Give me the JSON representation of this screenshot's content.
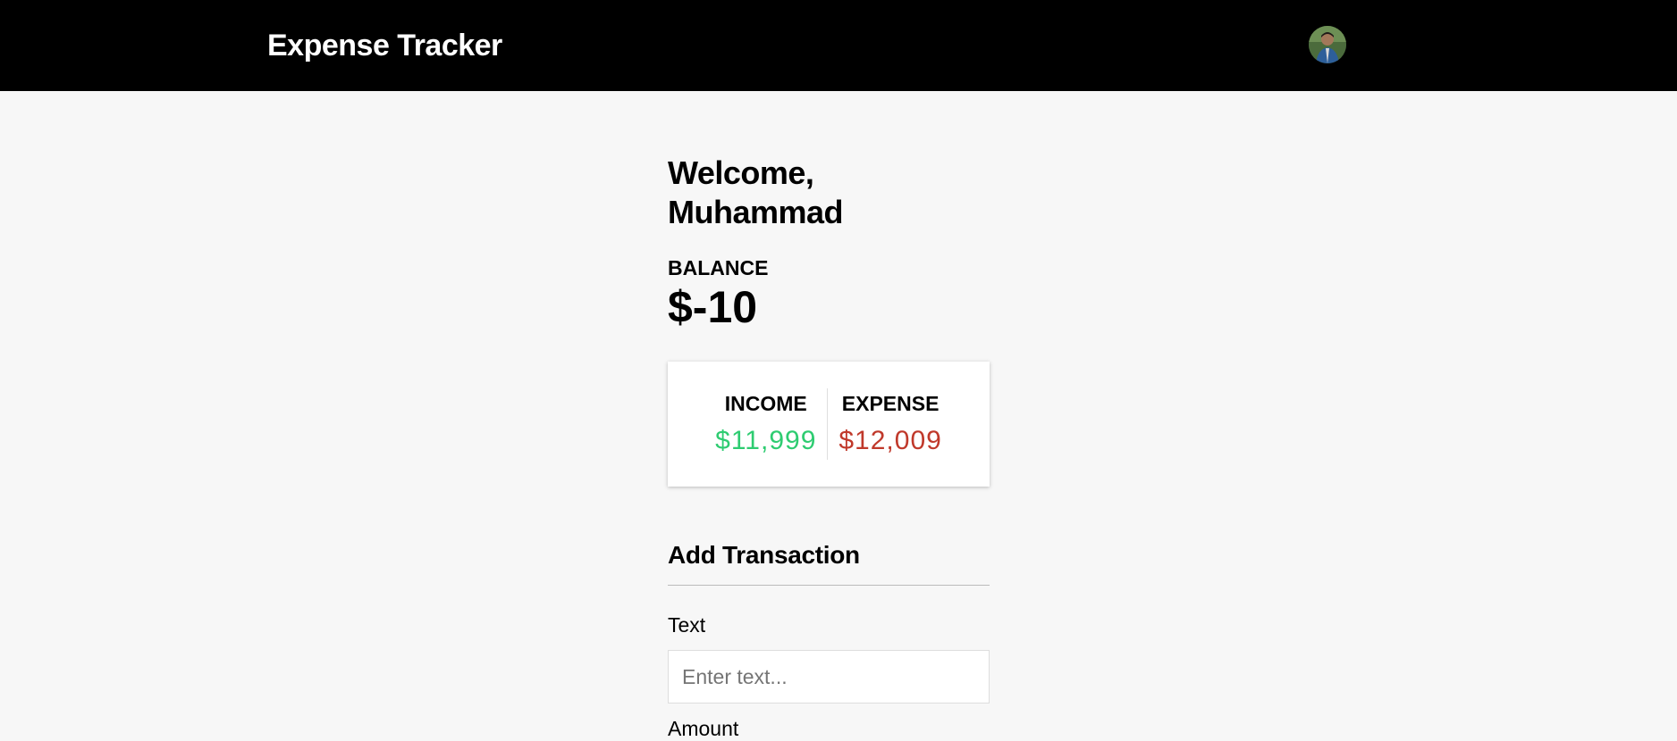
{
  "header": {
    "title": "Expense Tracker",
    "avatar_icon": "user-avatar"
  },
  "main": {
    "welcome": "Welcome, Muhammad",
    "balance_label": "BALANCE",
    "balance_value": "$-10",
    "income_label": "INCOME",
    "income_value": "$11,999",
    "expense_label": "EXPENSE",
    "expense_value": "$12,009",
    "income_color": "#2ecc71",
    "expense_color": "#c0392b"
  },
  "form": {
    "title": "Add Transaction",
    "text_label": "Text",
    "text_placeholder": "Enter text...",
    "amount_label": "Amount"
  }
}
